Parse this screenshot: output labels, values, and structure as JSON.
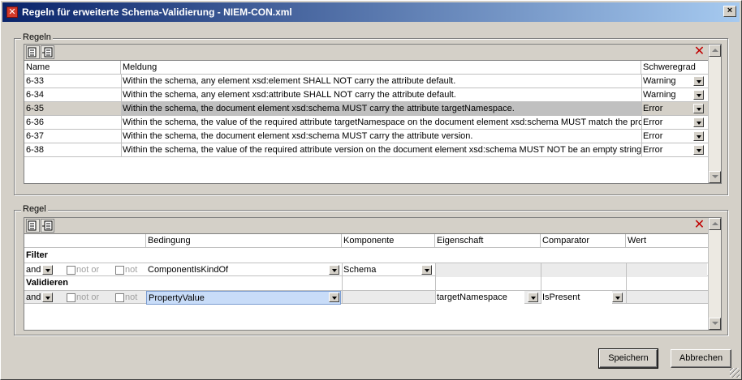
{
  "window": {
    "title": "Regeln für erweiterte Schema-Validierung - NIEM-CON.xml",
    "close_glyph": "×"
  },
  "rules_group": {
    "label": "Regeln",
    "columns": {
      "name": "Name",
      "message": "Meldung",
      "severity": "Schweregrad"
    },
    "rows": [
      {
        "name": "6-33",
        "message": "Within the schema, any element xsd:element SHALL NOT carry the attribute default.",
        "severity": "Warning"
      },
      {
        "name": "6-34",
        "message": "Within the schema, any element xsd:attribute SHALL NOT carry the attribute default.",
        "severity": "Warning"
      },
      {
        "name": "6-35",
        "message": "Within the schema, the document element xsd:schema MUST carry the attribute targetNamespace.",
        "severity": "Error"
      },
      {
        "name": "6-36",
        "message": "Within the schema, the value of the required attribute targetNamespace on the document element xsd:schema MUST match the produ",
        "severity": "Error"
      },
      {
        "name": "6-37",
        "message": "Within the schema, the document element xsd:schema MUST carry the attribute version.",
        "severity": "Error"
      },
      {
        "name": "6-38",
        "message": "Within the schema, the value of the required attribute version on the document element xsd:schema MUST NOT be an empty string.",
        "severity": "Error"
      }
    ],
    "selected_row": 2
  },
  "rule_group": {
    "label": "Regel",
    "columns": {
      "condition": "Bedingung",
      "component": "Komponente",
      "property": "Eigenschaft",
      "comparator": "Comparator",
      "value": "Wert"
    },
    "filter": {
      "heading": "Filter",
      "logic": "and",
      "not_or_label": "not or",
      "not_label": "not",
      "condition": "ComponentIsKindOf",
      "component": "Schema"
    },
    "validate": {
      "heading": "Validieren",
      "logic": "and",
      "not_or_label": "not or",
      "not_label": "not",
      "condition": "PropertyValue",
      "property": "targetNamespace",
      "comparator": "IsPresent"
    }
  },
  "buttons": {
    "save": "Speichern",
    "cancel": "Abbrechen"
  },
  "colors": {
    "titlebar_start": "#0a246a",
    "titlebar_end": "#a6caf0",
    "selection_blue": "#c8dcf8",
    "delete_red": "#c00000"
  },
  "icons": {
    "app": "x-icon",
    "add_row": "add-row-icon",
    "insert_row": "insert-row-icon",
    "delete": "delete-x-icon"
  }
}
